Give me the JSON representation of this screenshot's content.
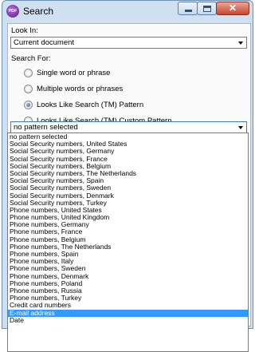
{
  "window": {
    "title": "Search",
    "app_icon_text": "PDF"
  },
  "look_in": {
    "label": "Look In:",
    "value": "Current document"
  },
  "search_for": {
    "label": "Search For:",
    "options": [
      {
        "label": "Single word or phrase",
        "checked": false
      },
      {
        "label": "Multiple words or phrases",
        "checked": false
      },
      {
        "label": "Looks Like Search (TM) Pattern",
        "checked": true
      },
      {
        "label": "Looks Like Search (TM) Custom Pattern",
        "checked": false
      }
    ]
  },
  "pattern": {
    "value": "no pattern selected",
    "options": [
      "no pattern selected",
      "Social Security numbers, United States",
      "Social Security numbers, Germany",
      "Social Security numbers, France",
      "Social Security numbers, Belgium",
      "Social Security numbers, The Netherlands",
      "Social Security numbers, Spain",
      "Social Security numbers, Sweden",
      "Social Security numbers, Denmark",
      "Social Security numbers, Turkey",
      "Phone numbers, United States",
      "Phone numbers, United Kingdom",
      "Phone numbers, Germany",
      "Phone numbers, France",
      "Phone numbers, Belgium",
      "Phone numbers, The Netherlands",
      "Phone numbers, Spain",
      "Phone numbers, Italy",
      "Phone numbers, Sweden",
      "Phone numbers, Denmark",
      "Phone numbers, Poland",
      "Phone numbers, Russia",
      "Phone numbers, Turkey",
      "Credit card numbers",
      "E-mail address",
      "Date"
    ],
    "highlighted": "E-mail address"
  }
}
